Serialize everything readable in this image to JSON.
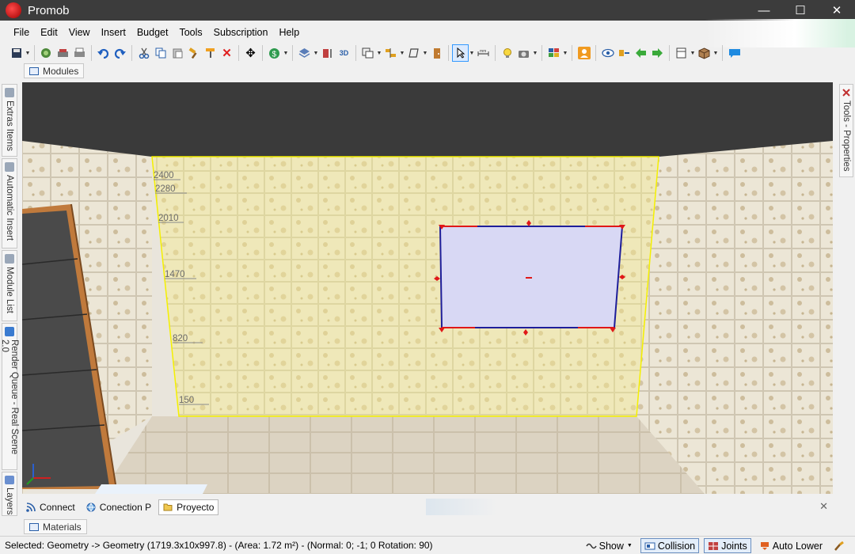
{
  "window": {
    "title": "Promob",
    "minimize": "—",
    "maximize": "☐",
    "close": "✕"
  },
  "menu": [
    "File",
    "Edit",
    "View",
    "Insert",
    "Budget",
    "Tools",
    "Subscription",
    "Help"
  ],
  "toolbar": {
    "icons": [
      "save-icon",
      "plugin-icon",
      "print-preview-icon",
      "print-icon",
      "undo-icon",
      "redo-icon",
      "cut-icon",
      "copy-icon",
      "paste-icon",
      "hammer-icon",
      "paint-roller-icon",
      "delete-icon",
      "move-icon",
      "money-icon",
      "layers-icon",
      "dimension-icon",
      "3d-icon",
      "select-mode-icon",
      "align-icon",
      "shape-icon",
      "door-icon",
      "pointer-icon",
      "measure-icon",
      "light-icon",
      "camera-icon",
      "view-layout-icon",
      "user-icon",
      "eye-icon",
      "walk-icon",
      "back-arrow-icon",
      "forward-arrow-icon",
      "window-icon",
      "box-icon",
      "chat-icon"
    ]
  },
  "panels": {
    "modules": "Modules",
    "materials": "Materials",
    "left_tabs": [
      "Extras Items",
      "Automatic Insert",
      "Module List",
      "Render Queue - Real Scene 2.0",
      "Layers"
    ],
    "right_tab": "Tools - Properties"
  },
  "viewport": {
    "wall_height_marks": [
      "2400",
      "2280",
      "2010",
      "1470",
      "820",
      "150"
    ]
  },
  "bottom_tabs": [
    "Connect",
    "Conection P",
    "Proyecto"
  ],
  "bottom_close": "✕",
  "status": {
    "text": "Selected: Geometry -> Geometry (1719.3x10x997.8) - (Area: 1.72 m²) - (Normal: 0; -1; 0 Rotation: 90)",
    "show": "Show",
    "collision": "Collision",
    "joints": "Joints",
    "auto_lower": "Auto Lower"
  },
  "colors": {
    "titlebar": "#3c3c3c",
    "selected_panel": "#d8d8f4",
    "selection_outline": "#f4f000",
    "handle_red": "#e01818"
  }
}
